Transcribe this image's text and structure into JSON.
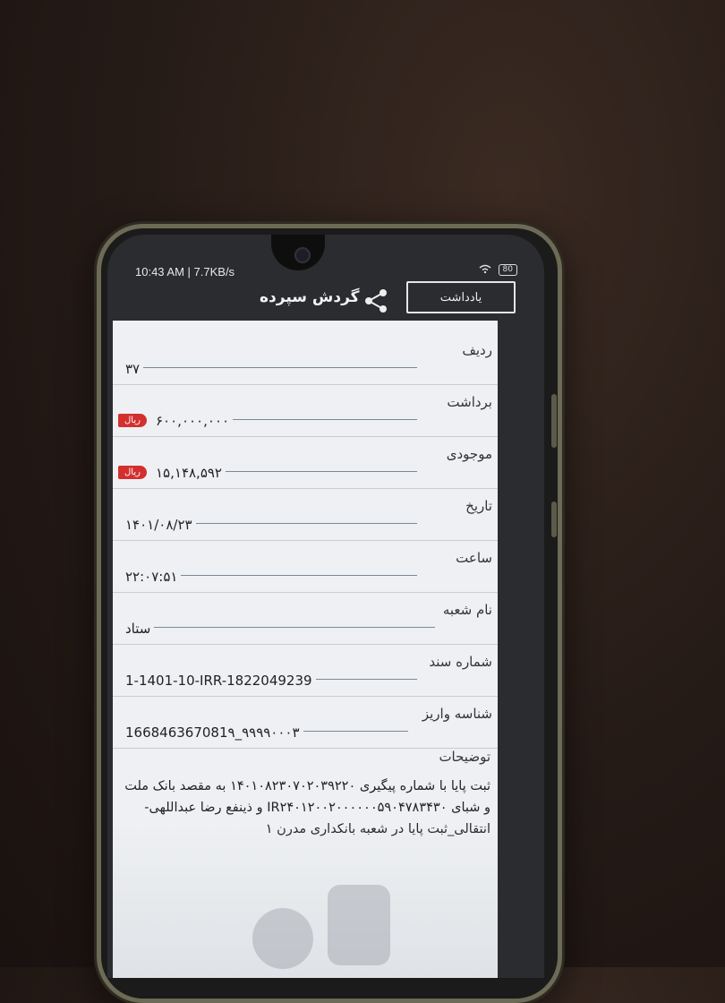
{
  "status_bar": {
    "time": "10:43 AM | 7.7KB/s",
    "battery": "80"
  },
  "app_bar": {
    "title": "گردش سپرده",
    "note_button": "یادداشت",
    "share_icon": "share-icon"
  },
  "rows": [
    {
      "label": "ردیف",
      "value": "۳۷"
    },
    {
      "label": "برداشت",
      "value": "۶۰۰,۰۰۰,۰۰۰",
      "badge": "ریال"
    },
    {
      "label": "موجودی",
      "value": "۱۵,۱۴۸,۵۹۲",
      "badge": "ریال"
    },
    {
      "label": "تاریخ",
      "value": "۱۴۰۱/۰۸/۲۳"
    },
    {
      "label": "ساعت",
      "value": "۲۲:۰۷:۵۱"
    },
    {
      "label": "نام شعبه",
      "value": "ستاد"
    },
    {
      "label": "شماره سند",
      "value": "1-1401-10-IRR-1822049239"
    },
    {
      "label": "شناسه واریز",
      "value": "166846367081۹_۹۹۹۹۰۰۰۳"
    }
  ],
  "description": {
    "label": "توضیحات",
    "text": "ثبت پایا با شماره پیگیری ۱۴۰۱۰۸۲۳۰۷۰۲۰۳۹۲۲۰ به مقصد بانک ملت و شبای IR۲۴۰۱۲۰۰۲۰۰۰۰۰۰۵۹۰۴۷۸۳۴۳۰ و ذینفع رضا عبداللهی- انتقالی_ثبت پایا در شعبه بانکداری مدرن ۱"
  },
  "colors": {
    "badge": "#d32f2f",
    "appbar": "#2a2c2f",
    "content": "#eef0f3"
  }
}
